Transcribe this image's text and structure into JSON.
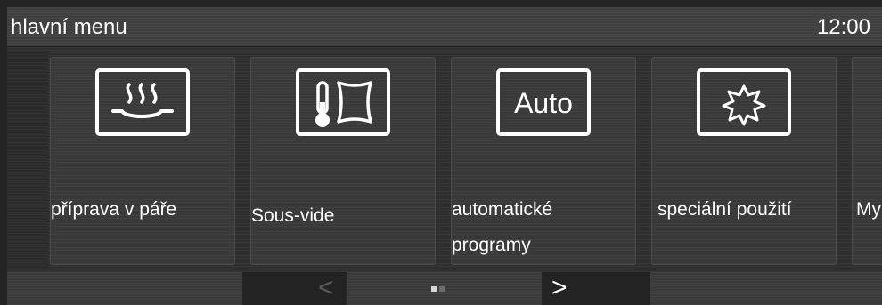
{
  "header": {
    "title": "hlavní menu",
    "clock": "12:00"
  },
  "tiles": [
    {
      "label": "příprava v páře",
      "icon": "steam-cooking-icon"
    },
    {
      "label": "Sous-vide",
      "icon": "sous-vide-icon"
    },
    {
      "label": "automatické\nprogramy",
      "icon": "auto-programs-icon",
      "icon_text": "Auto"
    },
    {
      "label": "speciální použití",
      "icon": "special-use-icon"
    },
    {
      "label": "My",
      "icon": ""
    }
  ],
  "navigation": {
    "prev": "<",
    "next": ">"
  },
  "pager": {
    "current_page": 1,
    "page_count": 2
  }
}
